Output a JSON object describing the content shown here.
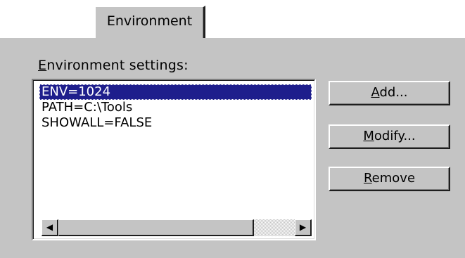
{
  "tab": {
    "label": "Environment"
  },
  "group": {
    "mnemonic": "E",
    "label_rest": "nvironment settings:"
  },
  "list": {
    "items": [
      "ENV=1024",
      "PATH=C:\\Tools",
      "SHOWALL=FALSE"
    ],
    "selected_index": 0
  },
  "buttons": {
    "add": {
      "mnemonic": "A",
      "rest": "dd..."
    },
    "modify": {
      "mnemonic": "M",
      "rest": "odify..."
    },
    "remove": {
      "mnemonic": "R",
      "rest": "emove"
    }
  },
  "scrollbar": {
    "left_arrow_icon": "scroll-left-icon",
    "right_arrow_icon": "scroll-right-icon"
  },
  "colors": {
    "face": "#c4c4c4",
    "selection": "#1e1e8c",
    "window": "#ffffff"
  }
}
